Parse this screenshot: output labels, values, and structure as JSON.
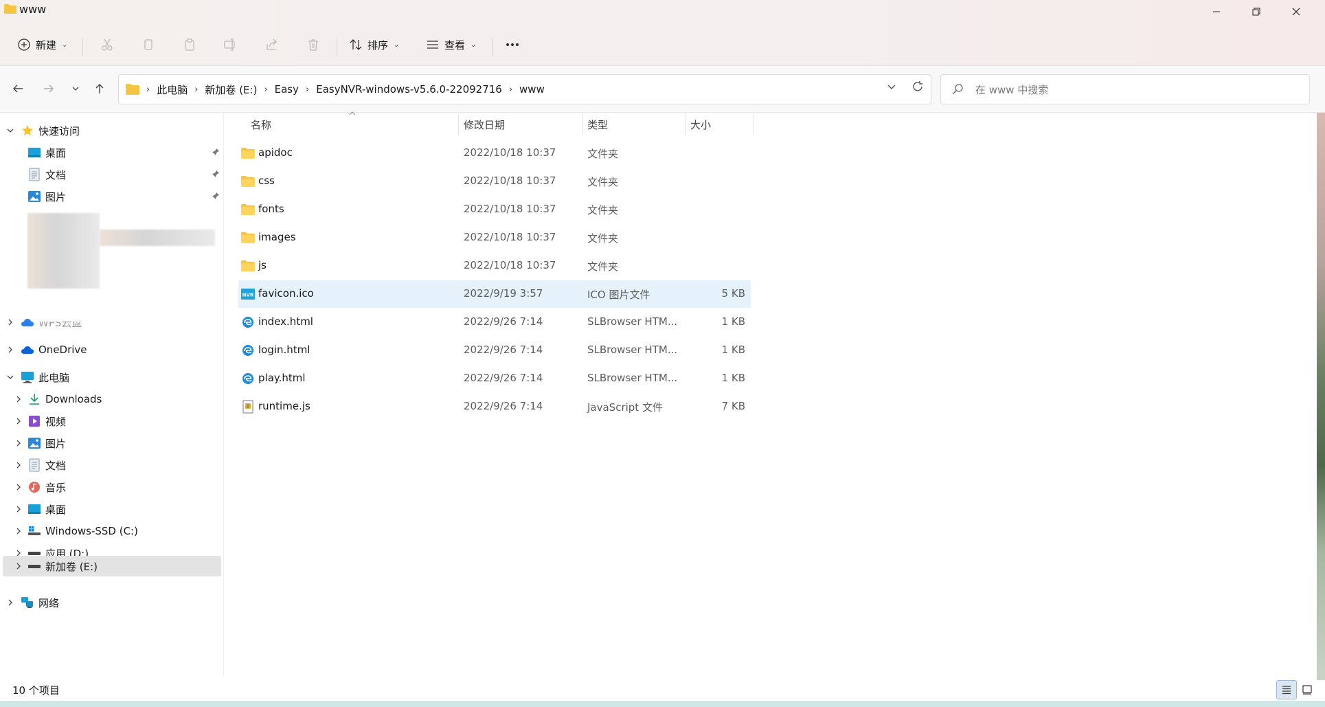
{
  "window": {
    "title": "www",
    "controls": {
      "minimize": "—",
      "maximize": "❐",
      "close": "✕"
    }
  },
  "toolbar": {
    "new_label": "新建",
    "sort_label": "排序",
    "view_label": "查看",
    "more_label": "···",
    "icons": [
      "add-icon",
      "cut-icon",
      "copy-icon",
      "paste-icon",
      "rename-icon",
      "share-icon",
      "delete-icon",
      "sort-icon",
      "view-icon",
      "more-icon"
    ]
  },
  "address": {
    "crumbs": [
      "此电脑",
      "新加卷 (E:)",
      "Easy",
      "EasyNVR-windows-v5.6.0-22092716",
      "www"
    ],
    "search_placeholder": "在 www 中搜索"
  },
  "sidebar": {
    "quick_access": {
      "label": "快速访问",
      "items": [
        {
          "label": "桌面",
          "icon": "desktop-icon"
        },
        {
          "label": "文档",
          "icon": "document-icon"
        },
        {
          "label": "图片",
          "icon": "pictures-icon"
        }
      ]
    },
    "wps_label": "WPS云盘",
    "onedrive_label": "OneDrive",
    "this_pc": {
      "label": "此电脑",
      "items": [
        {
          "label": "Downloads",
          "icon": "download-icon"
        },
        {
          "label": "视频",
          "icon": "video-icon"
        },
        {
          "label": "图片",
          "icon": "pictures-icon"
        },
        {
          "label": "文档",
          "icon": "document-icon"
        },
        {
          "label": "音乐",
          "icon": "music-icon"
        },
        {
          "label": "桌面",
          "icon": "desktop-icon"
        },
        {
          "label": "Windows-SSD (C:)",
          "icon": "drive-icon"
        },
        {
          "label": "应用 (D:)",
          "icon": "drive-icon"
        },
        {
          "label": "新加卷 (E:)",
          "icon": "drive-icon"
        }
      ]
    },
    "network_label": "网络"
  },
  "columns": {
    "name": "名称",
    "date": "修改日期",
    "type": "类型",
    "size": "大小"
  },
  "files": [
    {
      "name": "apidoc",
      "date": "2022/10/18 10:37",
      "type": "文件夹",
      "size": "",
      "icon": "folder-icon"
    },
    {
      "name": "css",
      "date": "2022/10/18 10:37",
      "type": "文件夹",
      "size": "",
      "icon": "folder-icon"
    },
    {
      "name": "fonts",
      "date": "2022/10/18 10:37",
      "type": "文件夹",
      "size": "",
      "icon": "folder-icon"
    },
    {
      "name": "images",
      "date": "2022/10/18 10:37",
      "type": "文件夹",
      "size": "",
      "icon": "folder-icon"
    },
    {
      "name": "js",
      "date": "2022/10/18 10:37",
      "type": "文件夹",
      "size": "",
      "icon": "folder-icon"
    },
    {
      "name": "favicon.ico",
      "date": "2022/9/19 3:57",
      "type": "ICO 图片文件",
      "size": "5 KB",
      "icon": "ico-file-icon"
    },
    {
      "name": "index.html",
      "date": "2022/9/26 7:14",
      "type": "SLBrowser HTM...",
      "size": "1 KB",
      "icon": "browser-file-icon"
    },
    {
      "name": "login.html",
      "date": "2022/9/26 7:14",
      "type": "SLBrowser HTM...",
      "size": "1 KB",
      "icon": "browser-file-icon"
    },
    {
      "name": "play.html",
      "date": "2022/9/26 7:14",
      "type": "SLBrowser HTM...",
      "size": "1 KB",
      "icon": "browser-file-icon"
    },
    {
      "name": "runtime.js",
      "date": "2022/9/26 7:14",
      "type": "JavaScript 文件",
      "size": "7 KB",
      "icon": "js-file-icon"
    }
  ],
  "status": {
    "count": "10 个项目"
  },
  "colors": {
    "folder": "#f4c542",
    "selected_row": "#e5f1fb",
    "selected_nav": "#e3e3e3",
    "accent": "#0067c0"
  }
}
